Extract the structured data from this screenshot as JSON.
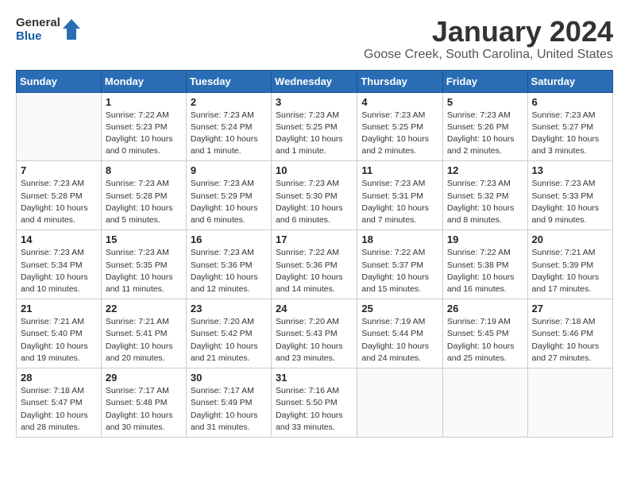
{
  "header": {
    "logo_line1": "General",
    "logo_line2": "Blue",
    "month_year": "January 2024",
    "location": "Goose Creek, South Carolina, United States"
  },
  "columns": [
    "Sunday",
    "Monday",
    "Tuesday",
    "Wednesday",
    "Thursday",
    "Friday",
    "Saturday"
  ],
  "weeks": [
    [
      {
        "day": "",
        "info": ""
      },
      {
        "day": "1",
        "info": "Sunrise: 7:22 AM\nSunset: 5:23 PM\nDaylight: 10 hours\nand 0 minutes."
      },
      {
        "day": "2",
        "info": "Sunrise: 7:23 AM\nSunset: 5:24 PM\nDaylight: 10 hours\nand 1 minute."
      },
      {
        "day": "3",
        "info": "Sunrise: 7:23 AM\nSunset: 5:25 PM\nDaylight: 10 hours\nand 1 minute."
      },
      {
        "day": "4",
        "info": "Sunrise: 7:23 AM\nSunset: 5:25 PM\nDaylight: 10 hours\nand 2 minutes."
      },
      {
        "day": "5",
        "info": "Sunrise: 7:23 AM\nSunset: 5:26 PM\nDaylight: 10 hours\nand 2 minutes."
      },
      {
        "day": "6",
        "info": "Sunrise: 7:23 AM\nSunset: 5:27 PM\nDaylight: 10 hours\nand 3 minutes."
      }
    ],
    [
      {
        "day": "7",
        "info": "Sunrise: 7:23 AM\nSunset: 5:28 PM\nDaylight: 10 hours\nand 4 minutes."
      },
      {
        "day": "8",
        "info": "Sunrise: 7:23 AM\nSunset: 5:28 PM\nDaylight: 10 hours\nand 5 minutes."
      },
      {
        "day": "9",
        "info": "Sunrise: 7:23 AM\nSunset: 5:29 PM\nDaylight: 10 hours\nand 6 minutes."
      },
      {
        "day": "10",
        "info": "Sunrise: 7:23 AM\nSunset: 5:30 PM\nDaylight: 10 hours\nand 6 minutes."
      },
      {
        "day": "11",
        "info": "Sunrise: 7:23 AM\nSunset: 5:31 PM\nDaylight: 10 hours\nand 7 minutes."
      },
      {
        "day": "12",
        "info": "Sunrise: 7:23 AM\nSunset: 5:32 PM\nDaylight: 10 hours\nand 8 minutes."
      },
      {
        "day": "13",
        "info": "Sunrise: 7:23 AM\nSunset: 5:33 PM\nDaylight: 10 hours\nand 9 minutes."
      }
    ],
    [
      {
        "day": "14",
        "info": "Sunrise: 7:23 AM\nSunset: 5:34 PM\nDaylight: 10 hours\nand 10 minutes."
      },
      {
        "day": "15",
        "info": "Sunrise: 7:23 AM\nSunset: 5:35 PM\nDaylight: 10 hours\nand 11 minutes."
      },
      {
        "day": "16",
        "info": "Sunrise: 7:23 AM\nSunset: 5:36 PM\nDaylight: 10 hours\nand 12 minutes."
      },
      {
        "day": "17",
        "info": "Sunrise: 7:22 AM\nSunset: 5:36 PM\nDaylight: 10 hours\nand 14 minutes."
      },
      {
        "day": "18",
        "info": "Sunrise: 7:22 AM\nSunset: 5:37 PM\nDaylight: 10 hours\nand 15 minutes."
      },
      {
        "day": "19",
        "info": "Sunrise: 7:22 AM\nSunset: 5:38 PM\nDaylight: 10 hours\nand 16 minutes."
      },
      {
        "day": "20",
        "info": "Sunrise: 7:21 AM\nSunset: 5:39 PM\nDaylight: 10 hours\nand 17 minutes."
      }
    ],
    [
      {
        "day": "21",
        "info": "Sunrise: 7:21 AM\nSunset: 5:40 PM\nDaylight: 10 hours\nand 19 minutes."
      },
      {
        "day": "22",
        "info": "Sunrise: 7:21 AM\nSunset: 5:41 PM\nDaylight: 10 hours\nand 20 minutes."
      },
      {
        "day": "23",
        "info": "Sunrise: 7:20 AM\nSunset: 5:42 PM\nDaylight: 10 hours\nand 21 minutes."
      },
      {
        "day": "24",
        "info": "Sunrise: 7:20 AM\nSunset: 5:43 PM\nDaylight: 10 hours\nand 23 minutes."
      },
      {
        "day": "25",
        "info": "Sunrise: 7:19 AM\nSunset: 5:44 PM\nDaylight: 10 hours\nand 24 minutes."
      },
      {
        "day": "26",
        "info": "Sunrise: 7:19 AM\nSunset: 5:45 PM\nDaylight: 10 hours\nand 25 minutes."
      },
      {
        "day": "27",
        "info": "Sunrise: 7:18 AM\nSunset: 5:46 PM\nDaylight: 10 hours\nand 27 minutes."
      }
    ],
    [
      {
        "day": "28",
        "info": "Sunrise: 7:18 AM\nSunset: 5:47 PM\nDaylight: 10 hours\nand 28 minutes."
      },
      {
        "day": "29",
        "info": "Sunrise: 7:17 AM\nSunset: 5:48 PM\nDaylight: 10 hours\nand 30 minutes."
      },
      {
        "day": "30",
        "info": "Sunrise: 7:17 AM\nSunset: 5:49 PM\nDaylight: 10 hours\nand 31 minutes."
      },
      {
        "day": "31",
        "info": "Sunrise: 7:16 AM\nSunset: 5:50 PM\nDaylight: 10 hours\nand 33 minutes."
      },
      {
        "day": "",
        "info": ""
      },
      {
        "day": "",
        "info": ""
      },
      {
        "day": "",
        "info": ""
      }
    ]
  ]
}
